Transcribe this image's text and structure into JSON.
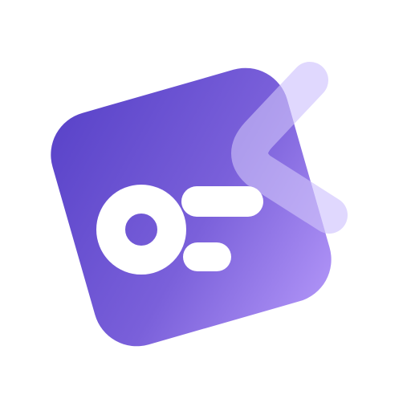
{
  "app_icon": {
    "name": "app-logo",
    "colors": {
      "background": "#ffffff",
      "tile_gradient_start": "#5b45c9",
      "tile_gradient_end": "#ad91f6",
      "glyph": "#ffffff",
      "accent_overlay": "#c9bcfb",
      "accent_overlay_light": "#e2dafe"
    },
    "icons": [
      "toggle-circle-icon",
      "menu-bars-icon",
      "chevron-left-accent-icon"
    ]
  }
}
